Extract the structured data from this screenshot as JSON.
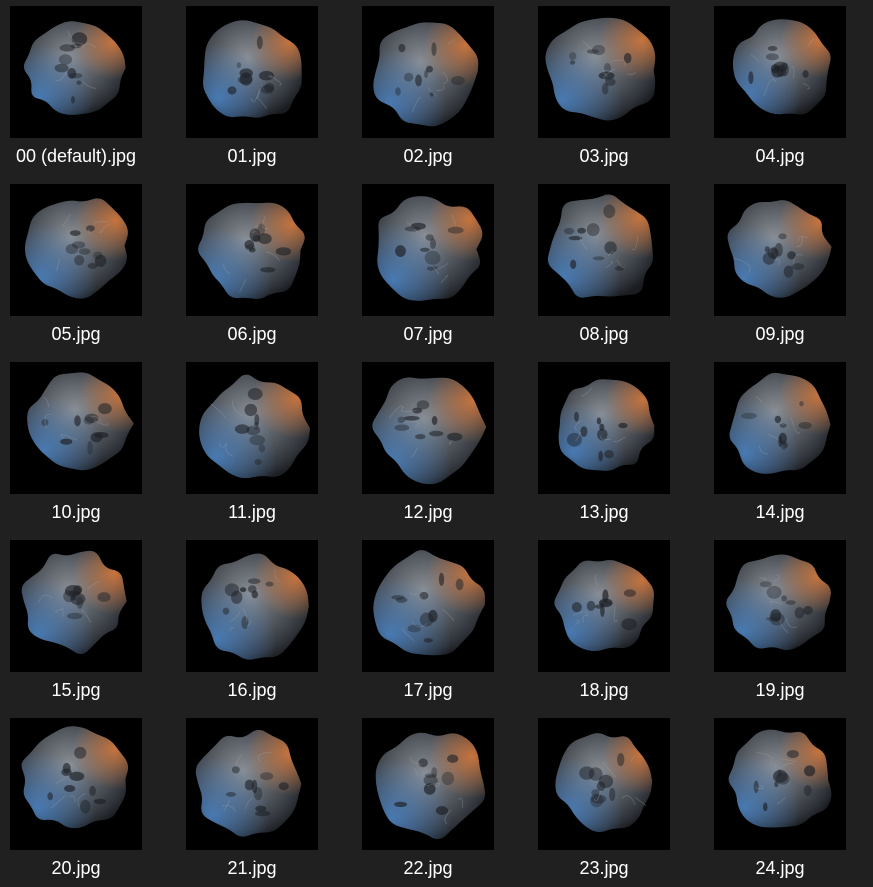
{
  "window": {
    "background_color": "#202020",
    "thumbnail_background": "#000000",
    "label_color": "#ffffff"
  },
  "files": [
    {
      "name": "00 (default).jpg",
      "icon": "rock-thumbnail-icon"
    },
    {
      "name": "01.jpg",
      "icon": "rock-thumbnail-icon"
    },
    {
      "name": "02.jpg",
      "icon": "rock-thumbnail-icon"
    },
    {
      "name": "03.jpg",
      "icon": "rock-thumbnail-icon"
    },
    {
      "name": "04.jpg",
      "icon": "rock-thumbnail-icon"
    },
    {
      "name": "05.jpg",
      "icon": "rock-thumbnail-icon"
    },
    {
      "name": "06.jpg",
      "icon": "rock-thumbnail-icon"
    },
    {
      "name": "07.jpg",
      "icon": "rock-thumbnail-icon"
    },
    {
      "name": "08.jpg",
      "icon": "rock-thumbnail-icon"
    },
    {
      "name": "09.jpg",
      "icon": "rock-thumbnail-icon"
    },
    {
      "name": "10.jpg",
      "icon": "rock-thumbnail-icon"
    },
    {
      "name": "11.jpg",
      "icon": "rock-thumbnail-icon"
    },
    {
      "name": "12.jpg",
      "icon": "rock-thumbnail-icon"
    },
    {
      "name": "13.jpg",
      "icon": "rock-thumbnail-icon"
    },
    {
      "name": "14.jpg",
      "icon": "rock-thumbnail-icon"
    },
    {
      "name": "15.jpg",
      "icon": "rock-thumbnail-icon"
    },
    {
      "name": "16.jpg",
      "icon": "rock-thumbnail-icon"
    },
    {
      "name": "17.jpg",
      "icon": "rock-thumbnail-icon"
    },
    {
      "name": "18.jpg",
      "icon": "rock-thumbnail-icon"
    },
    {
      "name": "19.jpg",
      "icon": "rock-thumbnail-icon"
    },
    {
      "name": "20.jpg",
      "icon": "rock-thumbnail-icon"
    },
    {
      "name": "21.jpg",
      "icon": "rock-thumbnail-icon"
    },
    {
      "name": "22.jpg",
      "icon": "rock-thumbnail-icon"
    },
    {
      "name": "23.jpg",
      "icon": "rock-thumbnail-icon"
    },
    {
      "name": "24.jpg",
      "icon": "rock-thumbnail-icon"
    }
  ]
}
